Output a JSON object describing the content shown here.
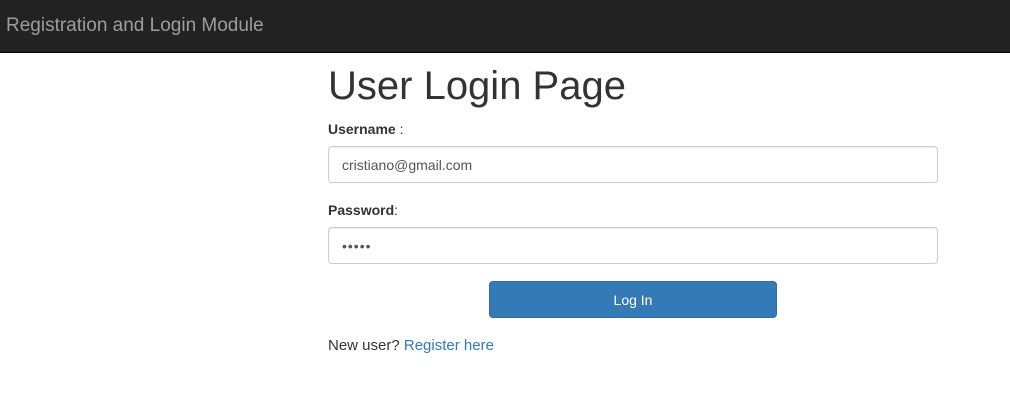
{
  "navbar": {
    "brand": "Registration and Login Module"
  },
  "main": {
    "title": "User Login Page",
    "username": {
      "label": "Username",
      "separator": " :",
      "value": "cristiano@gmail.com"
    },
    "password": {
      "label": "Password",
      "separator": ":",
      "value": "•••••"
    },
    "login_button": "Log In",
    "register": {
      "prompt": "New user?",
      "link_text": "Register here"
    }
  },
  "colors": {
    "navbar_bg": "#222222",
    "primary": "#337ab7",
    "link": "#337ab7",
    "text": "#333333"
  }
}
